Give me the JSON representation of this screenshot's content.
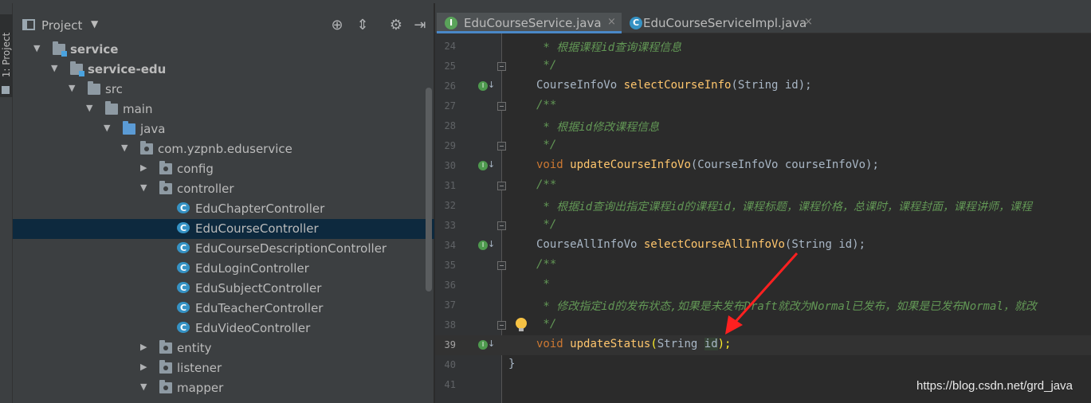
{
  "stripe": {
    "label": "1: Project"
  },
  "project": {
    "title": "Project",
    "tree": [
      {
        "label": "service",
        "bold": true
      },
      {
        "label": "service-edu",
        "bold": true
      },
      {
        "label": "src"
      },
      {
        "label": "main"
      },
      {
        "label": "java"
      },
      {
        "label": "com.yzpnb.eduservice"
      },
      {
        "label": "config"
      },
      {
        "label": "controller"
      },
      {
        "label": "EduChapterController"
      },
      {
        "label": "EduCourseController"
      },
      {
        "label": "EduCourseDescriptionController"
      },
      {
        "label": "EduLoginController"
      },
      {
        "label": "EduSubjectController"
      },
      {
        "label": "EduTeacherController"
      },
      {
        "label": "EduVideoController"
      },
      {
        "label": "entity"
      },
      {
        "label": "listener"
      },
      {
        "label": "mapper"
      }
    ]
  },
  "tabs": [
    {
      "label": "EduCourseService.java",
      "icon": "I",
      "close": "×"
    },
    {
      "label": "EduCourseServiceImpl.java",
      "icon": "C",
      "close": "×"
    }
  ],
  "editor": {
    "lines": [
      {
        "n": "24",
        "text": " * 根据课程id查询课程信息"
      },
      {
        "n": "25",
        "text": " */"
      },
      {
        "n": "26",
        "type": "CourseInfoVo",
        "name": "selectCourseInfo",
        "params": "(String id);"
      },
      {
        "n": "27",
        "text": "/**"
      },
      {
        "n": "28",
        "text": " * 根据id修改课程信息"
      },
      {
        "n": "29",
        "text": " */"
      },
      {
        "n": "30",
        "type": "void",
        "name": "updateCourseInfoVo",
        "params": "(CourseInfoVo courseInfoVo);"
      },
      {
        "n": "31",
        "text": "/**"
      },
      {
        "n": "32",
        "text": " * 根据id查询出指定课程id的课程id，课程标题，课程价格，总课时，课程封面，课程讲师，课程"
      },
      {
        "n": "33",
        "text": " */"
      },
      {
        "n": "34",
        "type": "CourseAllInfoVo",
        "name": "selectCourseAllInfoVo",
        "params": "(String id);"
      },
      {
        "n": "35",
        "text": "/**"
      },
      {
        "n": "36",
        "text": " *"
      },
      {
        "n": "37",
        "text": " * 修改指定id的发布状态,如果是未发布Draft就改为Normal已发布，如果是已发布Normal，就改"
      },
      {
        "n": "38",
        "text": " */"
      },
      {
        "n": "39",
        "type": "void",
        "name": "updateStatus",
        "open": "(",
        "param_type": "String ",
        "param_name": "id",
        "close": ");"
      },
      {
        "n": "40",
        "text": "}"
      },
      {
        "n": "41",
        "text": ""
      }
    ]
  },
  "watermark": "https://blog.csdn.net/grd_java",
  "colors": {
    "background": "#2b2b2b",
    "panel": "#3c3f41",
    "selection": "#0d293e",
    "keyword": "#cc7832",
    "method": "#ffc66d",
    "comment": "#629755",
    "arrow": "#ff2020"
  }
}
